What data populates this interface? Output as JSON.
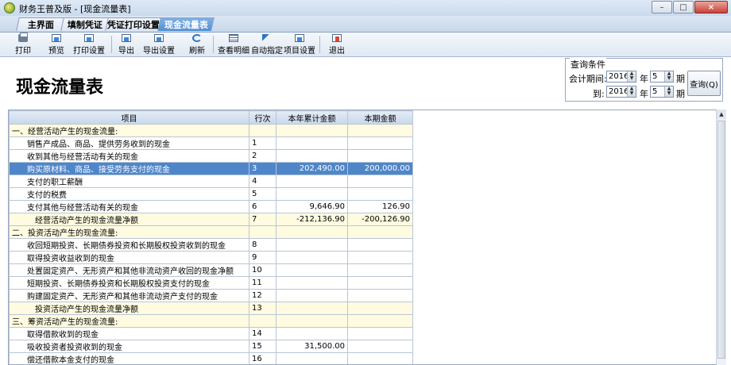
{
  "window": {
    "title": "财务王普及版 - [现金流量表]",
    "minimize": "–",
    "restore": "□",
    "close": "×"
  },
  "tabs": [
    {
      "label": "主界面",
      "active": false
    },
    {
      "label": "填制凭证",
      "active": false
    },
    {
      "label": "凭证打印设置",
      "active": false
    },
    {
      "label": "现金流量表",
      "active": true
    }
  ],
  "toolbar": [
    {
      "label": "打印",
      "icon": "printer-icon"
    },
    {
      "label": "预览",
      "icon": "preview-icon"
    },
    {
      "label": "打印设置",
      "icon": "print-settings-icon"
    },
    {
      "label": "导出",
      "icon": "export-icon"
    },
    {
      "label": "导出设置",
      "icon": "export-settings-icon"
    },
    {
      "label": "刷新",
      "icon": "refresh-icon"
    },
    {
      "label": "查看明细",
      "icon": "detail-icon"
    },
    {
      "label": "自动指定",
      "icon": "auto-assign-icon"
    },
    {
      "label": "项目设置",
      "icon": "item-settings-icon"
    },
    {
      "label": "退出",
      "icon": "exit-icon"
    }
  ],
  "report_title": "现金流量表",
  "query": {
    "legend": "查询条件",
    "period_label": "会计期间:",
    "to_label": "到:",
    "year_from": "2016",
    "month_from": "5",
    "year_to": "2016",
    "month_to": "5",
    "year_unit": "年",
    "month_unit": "期",
    "query_button": "查询(Q)"
  },
  "table": {
    "headers": [
      "项目",
      "行次",
      "本年累计金额",
      "本期金额"
    ],
    "rows": [
      {
        "item": "一、经营活动产生的现金流量:",
        "line": "",
        "ytd": "",
        "period": "",
        "type": "sec"
      },
      {
        "item": "销售产成品、商品、提供劳务收到的现金",
        "line": "1",
        "ytd": "",
        "period": "",
        "type": "item"
      },
      {
        "item": "收到其他与经营活动有关的现金",
        "line": "2",
        "ytd": "",
        "period": "",
        "type": "item"
      },
      {
        "item": "购买原材料、商品、接受劳务支付的现金",
        "line": "3",
        "ytd": "202,490.00",
        "period": "200,000.00",
        "type": "sel"
      },
      {
        "item": "支付的职工薪酬",
        "line": "4",
        "ytd": "",
        "period": "",
        "type": "item"
      },
      {
        "item": "支付的税费",
        "line": "5",
        "ytd": "",
        "period": "",
        "type": "item"
      },
      {
        "item": "支付其他与经营活动有关的现金",
        "line": "6",
        "ytd": "9,646.90",
        "period": "126.90",
        "type": "item"
      },
      {
        "item": "经营活动产生的现金流量净额",
        "line": "7",
        "ytd": "-212,136.90",
        "period": "-200,126.90",
        "type": "sub"
      },
      {
        "item": "二、投资活动产生的现金流量:",
        "line": "",
        "ytd": "",
        "period": "",
        "type": "sec"
      },
      {
        "item": "收回短期投资、长期债券投资和长期股权投资收到的现金",
        "line": "8",
        "ytd": "",
        "period": "",
        "type": "item"
      },
      {
        "item": "取得投资收益收到的现金",
        "line": "9",
        "ytd": "",
        "period": "",
        "type": "item"
      },
      {
        "item": "处置固定资产、无形资产和其他非流动资产收回的现金净额",
        "line": "10",
        "ytd": "",
        "period": "",
        "type": "item"
      },
      {
        "item": "短期投资、长期债券投资和长期股权投资支付的现金",
        "line": "11",
        "ytd": "",
        "period": "",
        "type": "item"
      },
      {
        "item": "购建固定资产、无形资产和其他非流动资产支付的现金",
        "line": "12",
        "ytd": "",
        "period": "",
        "type": "item"
      },
      {
        "item": "投资活动产生的现金流量净额",
        "line": "13",
        "ytd": "",
        "period": "",
        "type": "sub"
      },
      {
        "item": "三、筹资活动产生的现金流量:",
        "line": "",
        "ytd": "",
        "period": "",
        "type": "sec"
      },
      {
        "item": "取得借款收到的现金",
        "line": "14",
        "ytd": "",
        "period": "",
        "type": "item"
      },
      {
        "item": "吸收投资者投资收到的现金",
        "line": "15",
        "ytd": "31,500.00",
        "period": "",
        "type": "item"
      },
      {
        "item": "偿还借款本金支付的现金",
        "line": "16",
        "ytd": "",
        "period": "",
        "type": "item"
      }
    ]
  },
  "scrollbar": {
    "up": "▲"
  }
}
